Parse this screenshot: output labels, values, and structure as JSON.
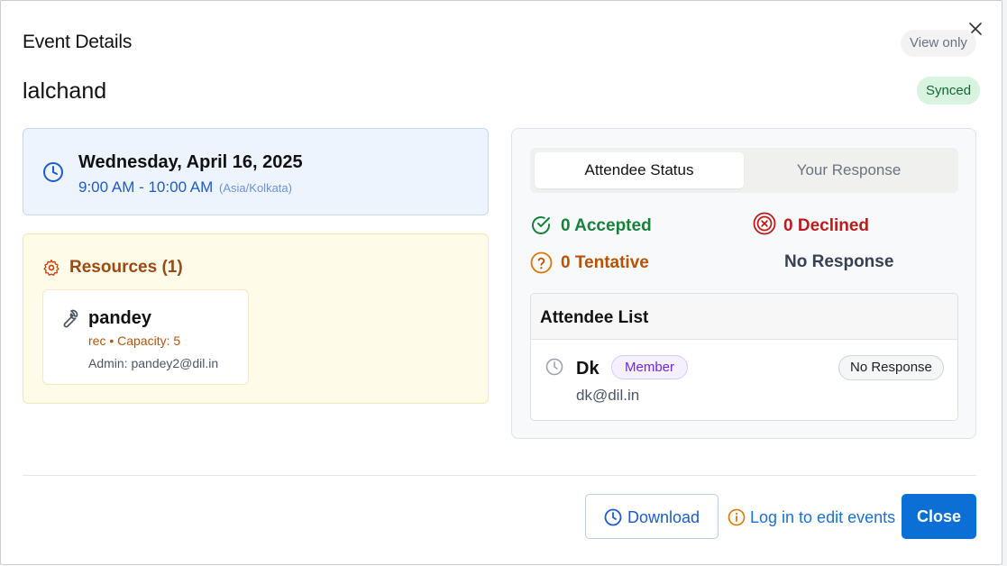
{
  "header": {
    "title": "Event Details",
    "view_only": "View only"
  },
  "event": {
    "name": "lalchand",
    "sync_status": "Synced",
    "date": "Wednesday, April 16, 2025",
    "time": "9:00 AM - 10:00 AM",
    "timezone": "(Asia/Kolkata)"
  },
  "resources": {
    "title": "Resources (1)",
    "items": [
      {
        "name": "pandey",
        "meta": "rec • Capacity: 5",
        "admin": "Admin: pandey2@dil.in"
      }
    ]
  },
  "attendees": {
    "tabs": [
      {
        "label": "Attendee Status",
        "active": true
      },
      {
        "label": "Your Response",
        "active": false
      }
    ],
    "stats": {
      "accepted": "0 Accepted",
      "declined": "0 Declined",
      "tentative": "0 Tentative",
      "no_response": "No Response"
    },
    "list_title": "Attendee List",
    "list": [
      {
        "name": "Dk",
        "role": "Member",
        "email": "dk@dil.in",
        "response": "No Response"
      }
    ]
  },
  "footer": {
    "download_label": "Download",
    "login_hint": "Log in to edit events",
    "close_label": "Close"
  },
  "colors": {
    "primary": "#0b6fd6",
    "accepted": "#18803d",
    "declined": "#b91c1c",
    "tentative": "#b45309"
  }
}
